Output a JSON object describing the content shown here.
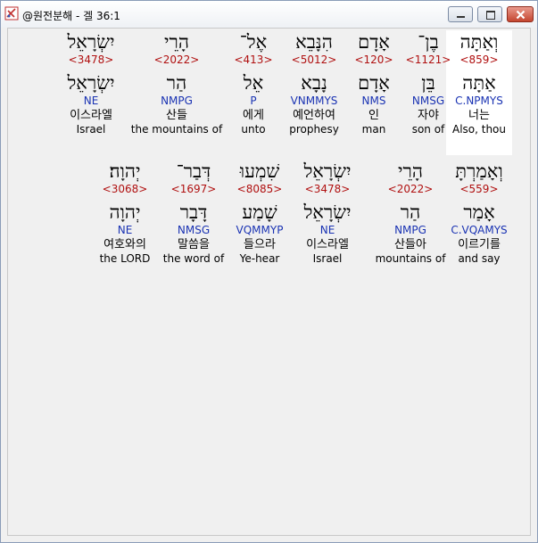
{
  "window": {
    "title": "@원전분해 - 겔 36:1"
  },
  "rows": [
    {
      "words": [
        {
          "heb": "וְאַתָּה",
          "strong": "<859>",
          "root": "אַתָּה",
          "morph": "C.NPMYS",
          "kor": "너는",
          "eng": "Also, thou",
          "selected": true
        },
        {
          "heb": "בֶן־",
          "strong": "<1121>",
          "root": "בֵּן",
          "morph": "NMSG",
          "kor": "자야",
          "eng": "son of",
          "selected": false
        },
        {
          "heb": "אָדָם",
          "strong": "<120>",
          "root": "אָדָם",
          "morph": "NMS",
          "kor": "인",
          "eng": "man",
          "selected": false
        },
        {
          "heb": "הִנָּבֵא",
          "strong": "<5012>",
          "root": "נָבָא",
          "morph": "VNMMYS",
          "kor": "예언하여",
          "eng": "prophesy",
          "selected": false
        },
        {
          "heb": "אֶל־",
          "strong": "<413>",
          "root": "אֵל",
          "morph": "P",
          "kor": "에게",
          "eng": "unto",
          "selected": false
        },
        {
          "heb": "הָרֵי",
          "strong": "<2022>",
          "root": "הַר",
          "morph": "NMPG",
          "kor": "산들",
          "eng": "the mountains of",
          "selected": false
        },
        {
          "heb": "יִשְׂרָאֵל",
          "strong": "<3478>",
          "root": "יִשְׂרָאֵל",
          "morph": "NE",
          "kor": "이스라엘",
          "eng": "Israel",
          "selected": false
        }
      ]
    },
    {
      "words": [
        {
          "heb": "וְאָמַרְתָּ",
          "strong": "<559>",
          "root": "אָמַר",
          "morph": "C.VQAMYS",
          "kor": "이르기를",
          "eng": "and say",
          "selected": false
        },
        {
          "heb": "הָרֵי",
          "strong": "<2022>",
          "root": "הַר",
          "morph": "NMPG",
          "kor": "산들아",
          "eng": "mountains of",
          "selected": false
        },
        {
          "heb": "יִשְׂרָאֵל",
          "strong": "<3478>",
          "root": "יִשְׂרָאֵל",
          "morph": "NE",
          "kor": "이스라엘",
          "eng": "Israel",
          "selected": false
        },
        {
          "heb": "שִׁמְעוּ",
          "strong": "<8085>",
          "root": "שָׁמַע",
          "morph": "VQMMYP",
          "kor": "들으라",
          "eng": "Ye-hear",
          "selected": false
        },
        {
          "heb": "דְּבַר־",
          "strong": "<1697>",
          "root": "דָּבָר",
          "morph": "NMSG",
          "kor": "말씀을",
          "eng": "the word of",
          "selected": false
        },
        {
          "heb": "יְהוָה׃",
          "strong": "<3068>",
          "root": "יְהוָה",
          "morph": "NE",
          "kor": "여호와의",
          "eng": "the LORD",
          "selected": false
        }
      ]
    }
  ]
}
